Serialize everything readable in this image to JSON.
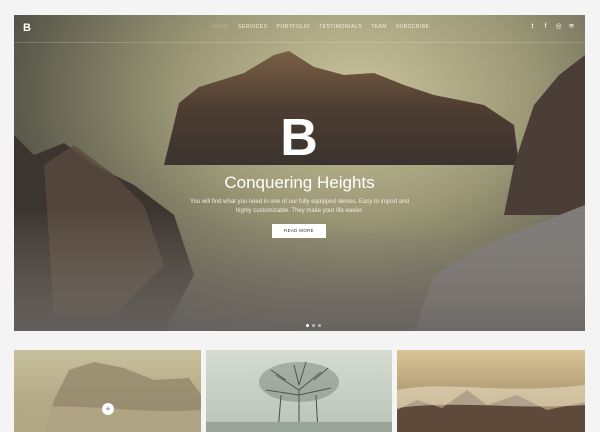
{
  "brand": {
    "logo": "B"
  },
  "nav": {
    "items": [
      {
        "label": "HOME",
        "active": true
      },
      {
        "label": "SERVICES",
        "active": false
      },
      {
        "label": "PORTFOLIO",
        "active": false
      },
      {
        "label": "TESTIMONIALS",
        "active": false
      },
      {
        "label": "TEAM",
        "active": false
      },
      {
        "label": "SUBSCRIBE",
        "active": false
      }
    ],
    "social": [
      {
        "icon": "twitter-icon",
        "glyph": "t"
      },
      {
        "icon": "facebook-icon",
        "glyph": "f"
      },
      {
        "icon": "instagram-icon",
        "glyph": "◎"
      },
      {
        "icon": "rss-icon",
        "glyph": "≋"
      }
    ]
  },
  "hero": {
    "big_letter": "B",
    "title": "Conquering Heights",
    "subtitle": "You will find what you need in one of our fully equipped demos. Easy to import and highly customizable. They make your life easier.",
    "button_label": "READ MORE",
    "slides": {
      "count": 3,
      "active": 1
    }
  },
  "portfolio": {
    "plus_icon": "plus-icon",
    "plus_glyph": "+"
  },
  "colors": {
    "accent_text": "#ffffff",
    "active_nav": "#b8b49c"
  }
}
